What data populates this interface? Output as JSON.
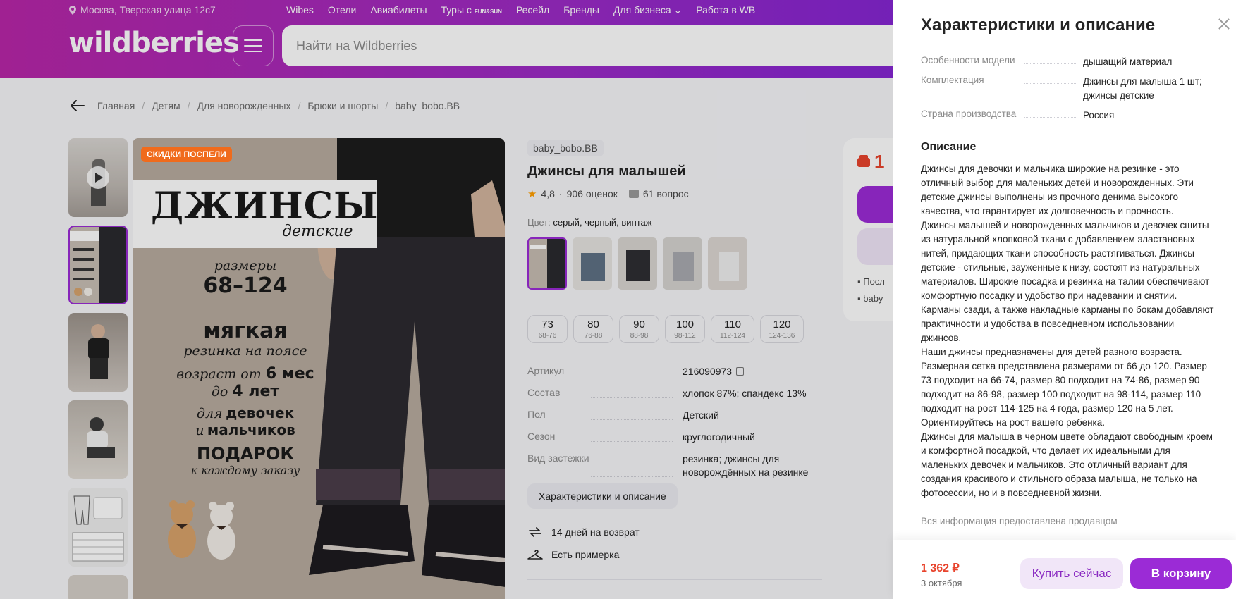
{
  "header": {
    "location": "Москва, Тверская улица 12с7",
    "nav": [
      "Wibes",
      "Отели",
      "Авиабилеты",
      "Туры с",
      "Ресейл",
      "Бренды",
      "Для бизнеса",
      "Работа в WB"
    ],
    "logo": "wildberries",
    "search_placeholder": "Найти на Wildberries",
    "brand_color": "#9c2bc6"
  },
  "breadcrumb": [
    "Главная",
    "Детям",
    "Для новорожденных",
    "Брюки и шорты",
    "baby_bobo.BB"
  ],
  "gallery": {
    "sale_badge": "СКИДКИ ПОСПЕЛИ",
    "image_text": {
      "title": "ДЖИНСЫ",
      "subtitle": "детские",
      "sizes_label": "размеры",
      "sizes_value": "68–124",
      "soft": "мягкая",
      "waist": "резинка на поясе",
      "age_prefix": "возраст от",
      "age_from": "6 мес",
      "age_to_prefix": "до",
      "age_to": "4 лет",
      "for_prefix": "для",
      "girls": "девочек",
      "and": "и",
      "boys": "мальчиков",
      "gift": "ПОДАРОК",
      "gift_sub": "к каждому заказу"
    }
  },
  "product": {
    "brand": "baby_bobo.BB",
    "title": "Джинсы для малышей",
    "rating": "4,8",
    "reviews": "906 оценок",
    "questions": "61 вопрос",
    "color_label": "Цвет:",
    "color_value": "серый, черный, винтаж",
    "sizes": [
      {
        "n": "73",
        "r": "68-76"
      },
      {
        "n": "80",
        "r": "76-88"
      },
      {
        "n": "90",
        "r": "88-98"
      },
      {
        "n": "100",
        "r": "98-112"
      },
      {
        "n": "110",
        "r": "112-124"
      },
      {
        "n": "120",
        "r": "124-136"
      }
    ],
    "specs": [
      {
        "k": "Артикул",
        "v": "216090973"
      },
      {
        "k": "Состав",
        "v": "хлопок 87%; спандекс 13%"
      },
      {
        "k": "Пол",
        "v": "Детский"
      },
      {
        "k": "Сезон",
        "v": "круглогодичный"
      },
      {
        "k": "Вид застежки",
        "v": "резинка; джинсы для новорождённых на резинке"
      }
    ],
    "chars_button": "Характеристики и описание",
    "return": "14 дней на возврат",
    "fitting": "Есть примерка"
  },
  "price_card": {
    "price_partial": "1",
    "line1": "Посл",
    "line2": "baby"
  },
  "panel": {
    "title": "Характеристики и описание",
    "specs": [
      {
        "k": "Особенности модели",
        "v": "дышащий материал"
      },
      {
        "k": "Комплектация",
        "v": "Джинсы для малыша 1 шт; джинсы детские"
      },
      {
        "k": "Страна производства",
        "v": "Россия"
      }
    ],
    "desc_title": "Описание",
    "description": "Джинсы для девочки и мальчика широкие на резинке - это отличный выбор для маленьких детей и новорожденных. Эти детские джинсы выполнены из прочного денима высокого качества, что гарантирует их долговечность и прочность.\nДжинсы малышей и новорожденных мальчиков и девочек сшиты из натуральной хлопковой ткани с добавлением эластановых нитей, придающих ткани способность растягиваться. Джинсы детские - стильные, зауженные к низу, состоят из натуральных материалов. Широкие посадка и резинка на талии обеспечивают комфортную посадку и удобство при надевании и снятии. Карманы сзади, а также накладные карманы по бокам добавляют практичности и удобства в повседневном использовании джинсов.\nНаши джинсы предназначены для детей разного возраста. Размерная сетка представлена размерами от 66 до 120. Размер 73 подходит на 66-74, размер 80 подходит на 74-86, размер 90 подходит на 86-98, размер 100 подходит на 98-114, размер 110 подходит на рост 114-125 на 4 года, размер 120 на 5 лет. Ориентируйтесь на рост вашего ребенка.\nДжинсы для малыша в черном цвете обладают свободным кроем и комфортной посадкой, что делает их идеальными для маленьких девочек и мальчиков. Это отличный вариант для создания красивого и стильного образа малыша, не только на фотосессии, но и в повседневной жизни.",
    "seller_note": "Вся информация предоставлена продавцом",
    "price": "1 362 ₽",
    "delivery": "3 октября",
    "buy_now": "Купить сейчас",
    "to_cart": "В корзину",
    "accent_color": "#9b2bd6",
    "price_color": "#e8442d"
  }
}
